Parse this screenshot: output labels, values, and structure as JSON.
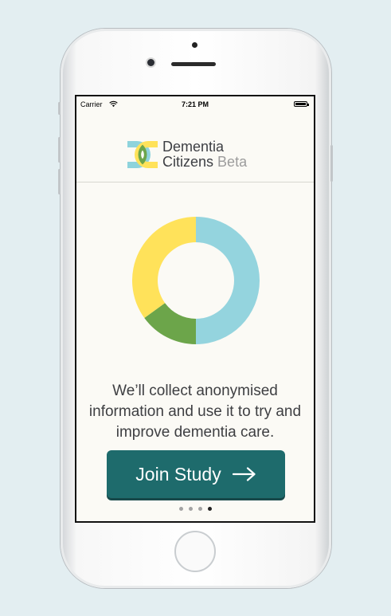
{
  "status_bar": {
    "carrier": "Carrier",
    "time": "7:21 PM"
  },
  "logo": {
    "line1": "Dementia",
    "line2": "Citizens",
    "beta": "Beta",
    "colors": {
      "teal": "#8ed3dc",
      "yellow": "#ffe25a",
      "green": "#6ca54a"
    }
  },
  "chart_data": {
    "type": "pie",
    "donut": true,
    "slices": [
      {
        "color": "#94d4de",
        "value": 50
      },
      {
        "color": "#6ca54a",
        "value": 15
      },
      {
        "color": "#ffe25a",
        "value": 35
      }
    ]
  },
  "onboarding": {
    "message": "We’ll collect anonymised information and use it to try and improve dementia care.",
    "join_label": "Join Study",
    "join_icon": "arrow-right-icon",
    "button_color": "#1e6b6c",
    "page_count": 4,
    "current_page": 4
  }
}
